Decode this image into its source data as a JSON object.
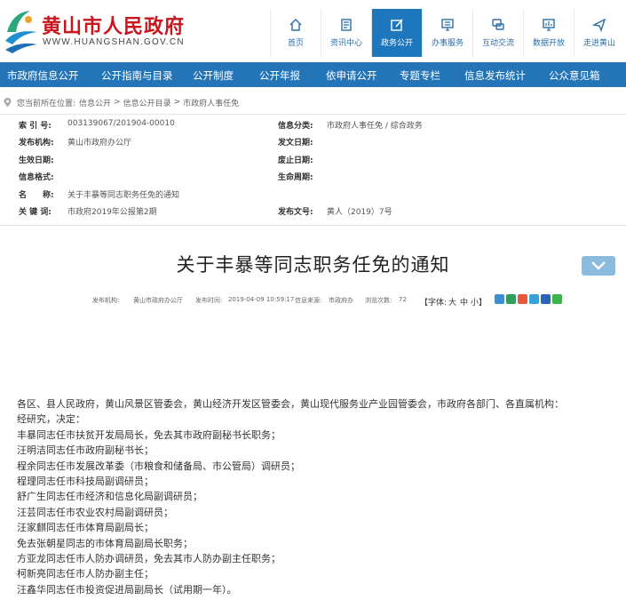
{
  "header": {
    "site_title": "黄山市人民政府",
    "site_url": "WWW.HUANGSHAN.GOV.CN",
    "brand_color": "#c8161d",
    "nav_items": [
      {
        "label": "首页",
        "icon": "home-icon"
      },
      {
        "label": "资讯中心",
        "icon": "news-icon"
      },
      {
        "label": "政务公开",
        "icon": "edit-icon"
      },
      {
        "label": "办事服务",
        "icon": "monitor-icon"
      },
      {
        "label": "互动交流",
        "icon": "chat-icon"
      },
      {
        "label": "数据开放",
        "icon": "data-screen-icon"
      },
      {
        "label": "走进黄山",
        "icon": "send-icon"
      }
    ],
    "active_index": 2
  },
  "mainnav": {
    "color": "#2475b8",
    "items": [
      "市政府信息公开",
      "公开指南与目录",
      "公开制度",
      "公开年报",
      "依申请公开",
      "专题专栏",
      "信息发布统计",
      "公众意见箱"
    ]
  },
  "breadcrumb": {
    "prefix": "您当前所在位置:",
    "items": [
      "信息公开",
      "信息公开目录",
      "市政府人事任免"
    ],
    "separator": ">"
  },
  "info": {
    "index_label": "索 引 号:",
    "index_value": "003139067/201904-00010",
    "category_label": "信息分类:",
    "category_value": "市政府人事任免 / 综合政务",
    "publisher_label": "发布机构:",
    "publisher_value": "黄山市政府办公厅",
    "doc_date_label": "发文日期:",
    "doc_date_value": "",
    "effective_label": "生效日期:",
    "effective_value": "",
    "repeal_label": "废止日期:",
    "repeal_value": "",
    "format_label": "信息格式:",
    "format_value": "",
    "lifecycle_label": "生命周期:",
    "lifecycle_value": "",
    "name_label": "名　　称:",
    "name_value": "关于丰暴等同志职务任免的通知",
    "keyword_label": "关 键 词:",
    "keyword_value": "市政府2019年公报第2期",
    "docno_label": "发布文号:",
    "docno_value": "黄人（2019）7号"
  },
  "article": {
    "title": "关于丰暴等同志职务任免的通知",
    "meta": {
      "org_label": "发布机构:",
      "org_value": "黄山市政府办公厅",
      "time_label": "发布时间:",
      "time_value": "2019-04-09 10:59:17",
      "source_label": "信息来源:",
      "source_value": "市政府办",
      "views_label": "浏览次数:",
      "views_value": "72",
      "fontsize_label": "【字体:",
      "fontsize_big": "大",
      "fontsize_mid": "中",
      "fontsize_small": "小】"
    },
    "paragraphs": [
      "各区、县人民政府，黄山风景区管委会，黄山经济开发区管委会，黄山现代服务业产业园管委会，市政府各部门、各直属机构：",
      "经研究，决定：",
      "丰暴同志任市扶贫开发局局长，免去其市政府副秘书长职务；",
      "汪明洁同志任市政府副秘书长；",
      "程余同志任市发展改革委（市粮食和储备局、市公管局）调研员；",
      "程理同志任市科技局副调研员；",
      "舒广生同志任市经济和信息化局副调研员；",
      "汪芸同志任市农业农村局副调研员；",
      "汪家麒同志任市体育局副局长；",
      "免去张朝星同志的市体育局副局长职务；",
      "方亚龙同志任市人防办调研员，免去其市人防办副主任职务；",
      "柯新亮同志任市人防办副主任；",
      "汪鑫华同志任市投资促进局副局长（试用期一年）。"
    ]
  }
}
